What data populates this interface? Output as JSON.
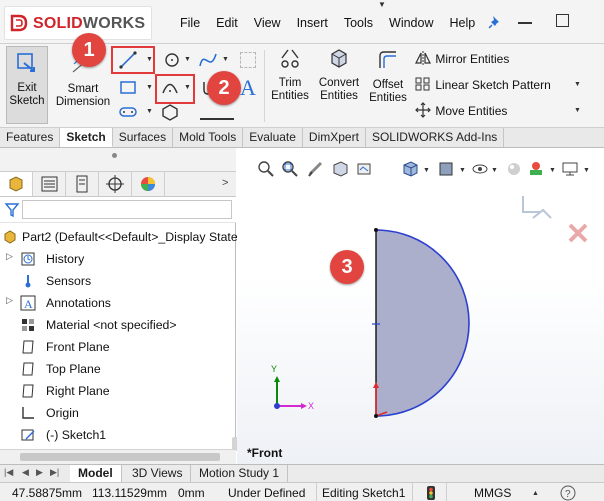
{
  "app": {
    "brand_prefix": "SOLID",
    "brand_suffix": "WORKS"
  },
  "menu": {
    "items": [
      "File",
      "Edit",
      "View",
      "Insert",
      "Tools",
      "Window",
      "Help"
    ]
  },
  "ribbon": {
    "exit_sketch": "Exit Sketch",
    "smart_dimension": "Smart Dimension",
    "trim_entities": "Trim Entities",
    "convert_entities": "Convert Entities",
    "offset_entities": "Offset Entities",
    "mirror_entities": "Mirror Entities",
    "linear_sketch_pattern": "Linear Sketch Pattern",
    "move_entities": "Move Entities"
  },
  "annotations": {
    "badge_1": "1",
    "badge_2": "2",
    "badge_3": "3"
  },
  "tabs": [
    "Features",
    "Sketch",
    "Surfaces",
    "Mold Tools",
    "Evaluate",
    "DimXpert",
    "SOLIDWORKS Add-Ins"
  ],
  "active_tab": "Sketch",
  "tree": {
    "root": "Part2  (Default<<Default>_Display State",
    "items": [
      "History",
      "Sensors",
      "Annotations",
      "Material <not specified>",
      "Front Plane",
      "Top Plane",
      "Right Plane",
      "Origin",
      "(-) Sketch1"
    ]
  },
  "viewport": {
    "orientation_label": "*Front",
    "axis_x": "X",
    "axis_y": "Y"
  },
  "bottom_tabs": [
    "Model",
    "3D Views",
    "Motion Study 1"
  ],
  "status": {
    "x": "47.58875mm",
    "y": "113.11529mm",
    "z": "0mm",
    "state": "Under Defined",
    "editing": "Editing Sketch1",
    "units": "MMGS"
  },
  "colors": {
    "brand_red": "#d0242a",
    "badge_red": "#e2443f",
    "sketch_blue": "#2b3fd0",
    "region_fill": "#a6abc9"
  }
}
